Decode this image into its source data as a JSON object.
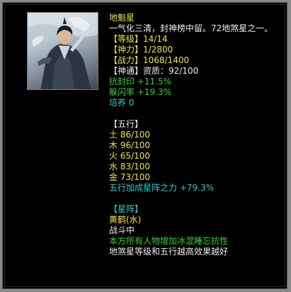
{
  "card": {
    "name": "地魁星",
    "description": "一气化三清，封神榜中留。72地煞星之一。",
    "level": {
      "label": "【等级】",
      "value": "14/14"
    },
    "divine_power": {
      "label": "【神力】",
      "value": "1/2800"
    },
    "combat_power": {
      "label": "【战力】",
      "value": "1068/1400"
    },
    "divine_link": {
      "label": "【神通】",
      "value": "资质：92/100"
    },
    "stats": [
      {
        "label": "抗封印",
        "value": "+11.5%"
      },
      {
        "label": "躲闪率",
        "value": "+19.3%"
      }
    ],
    "training": {
      "label": "培养",
      "value": "0"
    }
  },
  "elements": {
    "header": "【五行】",
    "items": [
      {
        "label": "土",
        "value": "86/100"
      },
      {
        "label": "木",
        "value": "96/100"
      },
      {
        "label": "火",
        "value": "65/100"
      },
      {
        "label": "水",
        "value": "83/100"
      },
      {
        "label": "金",
        "value": "73/100"
      }
    ],
    "bonus_label": "五行加成星阵之力",
    "bonus_value": "+79.3%"
  },
  "formation": {
    "header": "【星阵】",
    "name": "黄鹤(水)",
    "status": "战斗中",
    "effect": "本方所有人物增加冰混睡忘抗性",
    "note": "地煞星等级和五行越高效果越好"
  },
  "colors": {
    "background": "#000000",
    "yellow": "#f0e24a",
    "white": "#ececec",
    "green": "#36d236",
    "cyan": "#38c6c6"
  }
}
